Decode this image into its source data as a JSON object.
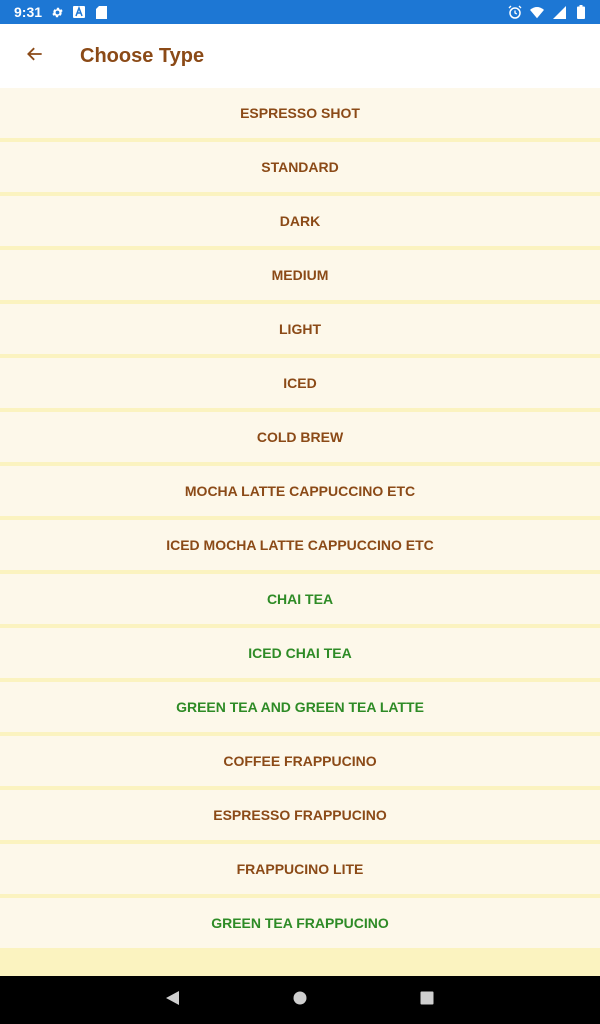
{
  "status_bar": {
    "time": "9:31",
    "icons_left": [
      "gear-icon",
      "a-icon",
      "sd-card-icon"
    ],
    "icons_right": [
      "alarm-icon",
      "wifi-icon",
      "signal-icon",
      "battery-icon"
    ]
  },
  "app_bar": {
    "title": "Choose Type",
    "back_icon": "arrow-left-icon"
  },
  "colors": {
    "status_bar": "#1d77d4",
    "brown_text": "#8b4a17",
    "green_text": "#2e8b26",
    "row_bg": "#fdf8ea",
    "list_bg": "#fbf3c0"
  },
  "items": [
    {
      "label": "ESPRESSO SHOT",
      "color": "brown"
    },
    {
      "label": "STANDARD",
      "color": "brown"
    },
    {
      "label": "DARK",
      "color": "brown"
    },
    {
      "label": "MEDIUM",
      "color": "brown"
    },
    {
      "label": "LIGHT",
      "color": "brown"
    },
    {
      "label": "ICED",
      "color": "brown"
    },
    {
      "label": "COLD BREW",
      "color": "brown"
    },
    {
      "label": "MOCHA LATTE CAPPUCCINO ETC",
      "color": "brown"
    },
    {
      "label": "ICED MOCHA LATTE CAPPUCCINO ETC",
      "color": "brown"
    },
    {
      "label": "CHAI TEA",
      "color": "green"
    },
    {
      "label": "ICED CHAI TEA",
      "color": "green"
    },
    {
      "label": "GREEN TEA AND GREEN TEA LATTE",
      "color": "green"
    },
    {
      "label": "COFFEE FRAPPUCINO",
      "color": "brown"
    },
    {
      "label": "ESPRESSO FRAPPUCINO",
      "color": "brown"
    },
    {
      "label": "FRAPPUCINO LITE",
      "color": "brown"
    },
    {
      "label": "GREEN TEA FRAPPUCINO",
      "color": "green"
    }
  ],
  "nav_bar": {
    "back": "triangle-back-icon",
    "home": "circle-home-icon",
    "recents": "square-recents-icon"
  }
}
